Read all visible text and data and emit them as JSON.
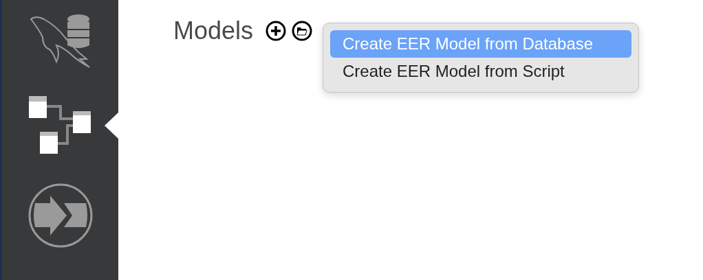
{
  "sidebar": {
    "items": [
      {
        "kind": "home",
        "selected": false
      },
      {
        "kind": "models",
        "selected": true
      },
      {
        "kind": "migration",
        "selected": false
      }
    ]
  },
  "main": {
    "title": "Models"
  },
  "menu": {
    "items": [
      {
        "label": "Create EER Model from Database",
        "selected": true
      },
      {
        "label": "Create EER Model from Script",
        "selected": false
      }
    ]
  }
}
